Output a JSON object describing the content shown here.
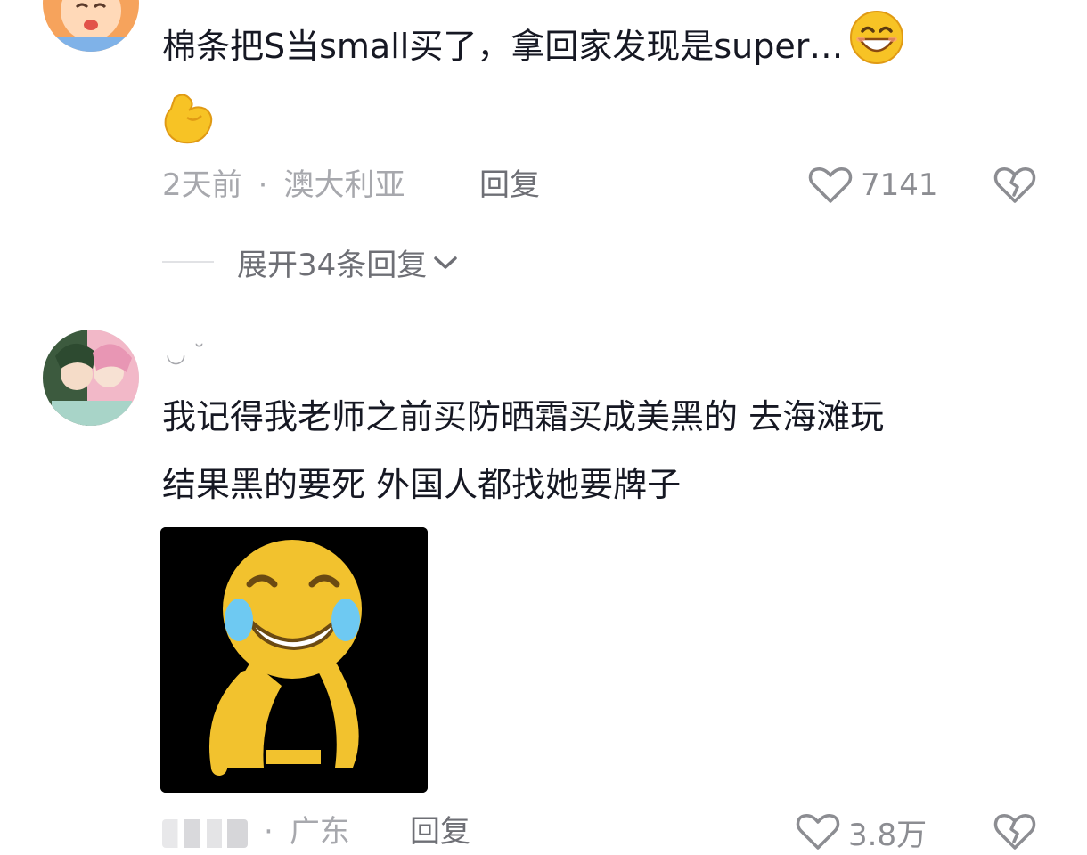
{
  "comments": [
    {
      "username": "",
      "text": "棉条把S当small买了，拿回家发现是super…",
      "time": "2天前",
      "location": "澳大利亚",
      "reply_label": "回复",
      "likes": "7141",
      "expand_label": "展开34条回复"
    },
    {
      "username": "◡ ˘",
      "text_line1": "我记得我老师之前买防晒霜买成美黑的 去海滩玩",
      "text_line2": "结果黑的要死 外国人都找她要牌子",
      "time": "",
      "location": "广东",
      "reply_label": "回复",
      "likes": "3.8万"
    }
  ],
  "icons": {
    "like": "heart-outline-icon",
    "dislike": "broken-heart-icon",
    "expand": "chevron-down-icon"
  },
  "colors": {
    "text": "#161823",
    "muted": "#a7a8ad",
    "reply": "#6e6f75"
  }
}
